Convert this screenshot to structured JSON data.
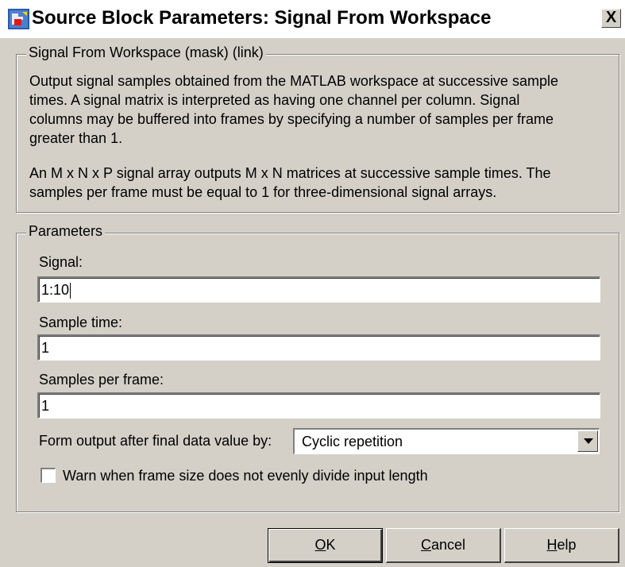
{
  "window": {
    "title": "Source Block Parameters: Signal From Workspace",
    "close_label": "X"
  },
  "description_group": {
    "legend": "Signal From Workspace (mask) (link)",
    "paragraph1": [
      "Output signal samples obtained from the MATLAB workspace at successive sample",
      "times.  A signal matrix is interpreted as having one channel per column.  Signal",
      "columns may be buffered into frames by specifying a number of samples per frame",
      "greater than 1."
    ],
    "paragraph2": [
      "An M x N x P signal array outputs M x N matrices at successive sample times.  The",
      "samples per frame must be equal to 1 for three-dimensional signal arrays."
    ]
  },
  "parameters": {
    "legend": "Parameters",
    "signal": {
      "label": "Signal:",
      "value": "1:10"
    },
    "sample_time": {
      "label": "Sample time:",
      "value": "1"
    },
    "samples_per_frame": {
      "label": "Samples per frame:",
      "value": "1"
    },
    "form_output": {
      "label": "Form output after final data value by:",
      "selected": "Cyclic repetition"
    },
    "warn_checkbox": {
      "label": "Warn when frame size does not evenly divide input length",
      "checked": false
    }
  },
  "buttons": {
    "ok": {
      "mnemonic": "O",
      "rest": "K"
    },
    "cancel": {
      "mnemonic": "C",
      "rest": "ancel"
    },
    "help": {
      "mnemonic": "H",
      "rest": "elp"
    }
  },
  "colors": {
    "window_face": "#d4d0c8",
    "title_bar": "#ffffff"
  }
}
